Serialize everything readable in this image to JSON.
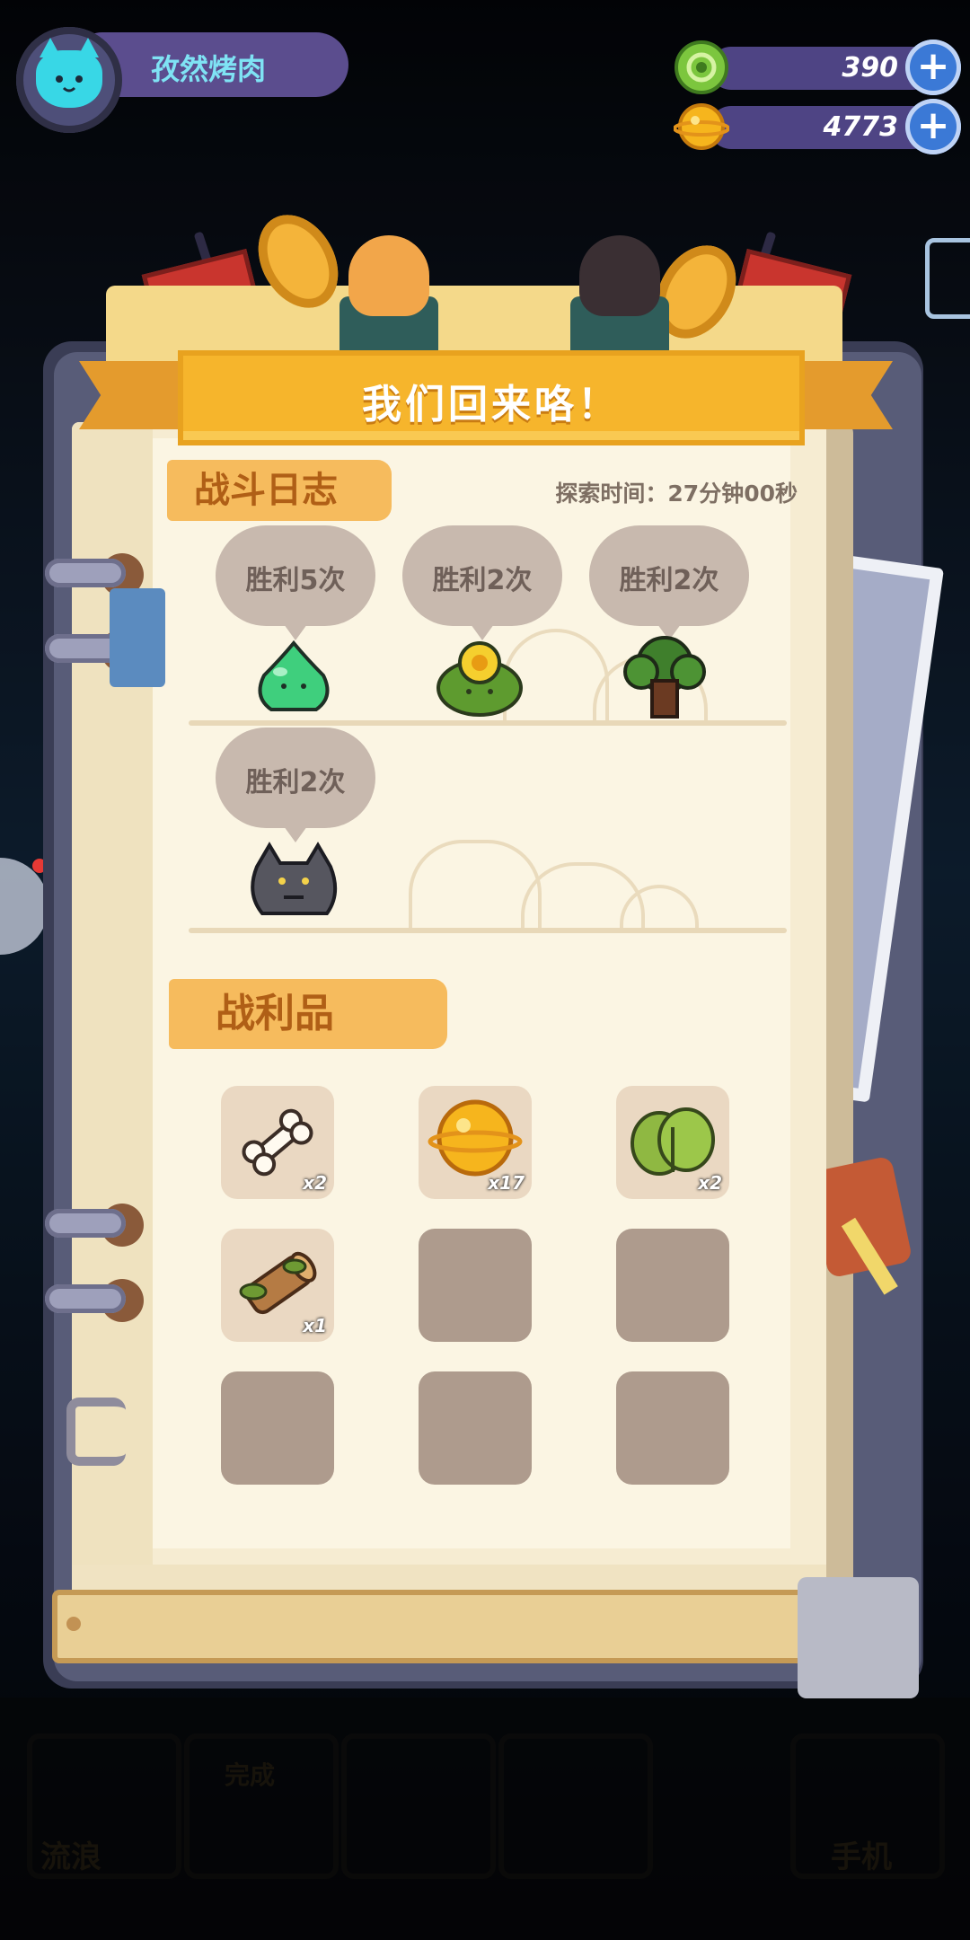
{
  "player": {
    "name": "孜然烤肉"
  },
  "currencies": [
    {
      "icon": "green-ring-coin-icon",
      "value": "390",
      "color": "#6fbf3a"
    },
    {
      "icon": "gold-planet-coin-icon",
      "value": "4773",
      "color": "#f5b31c"
    }
  ],
  "banner": {
    "title": "我们回来咯！"
  },
  "battle_log": {
    "title": "战斗日志",
    "time_text": "探索时间：27分钟00秒",
    "entries": [
      {
        "label": "胜利5次",
        "monster": "green-slime-icon"
      },
      {
        "label": "胜利2次",
        "monster": "yellow-flower-bush-icon"
      },
      {
        "label": "胜利2次",
        "monster": "tree-monster-icon"
      },
      {
        "label": "胜利2次",
        "monster": "grey-wolf-icon"
      }
    ]
  },
  "loot": {
    "title": "战利品",
    "items": [
      {
        "icon": "bone-icon",
        "count": "x2"
      },
      {
        "icon": "gold-coin-icon",
        "count": "x17"
      },
      {
        "icon": "leaf-icon",
        "count": "x2"
      },
      {
        "icon": "wood-log-icon",
        "count": "x1"
      },
      {
        "icon": "empty-slot",
        "count": ""
      },
      {
        "icon": "empty-slot",
        "count": ""
      },
      {
        "icon": "empty-slot",
        "count": ""
      },
      {
        "icon": "empty-slot",
        "count": ""
      },
      {
        "icon": "empty-slot",
        "count": ""
      }
    ]
  },
  "bottom_nav": {
    "left_label": "流浪",
    "center_label": "完成",
    "right_label": "手机"
  },
  "colors": {
    "banner": "#f6b52c",
    "section_tag": "#f6bb5d",
    "plus_button": "#3b79d6",
    "currency_bar": "#4e4484"
  }
}
